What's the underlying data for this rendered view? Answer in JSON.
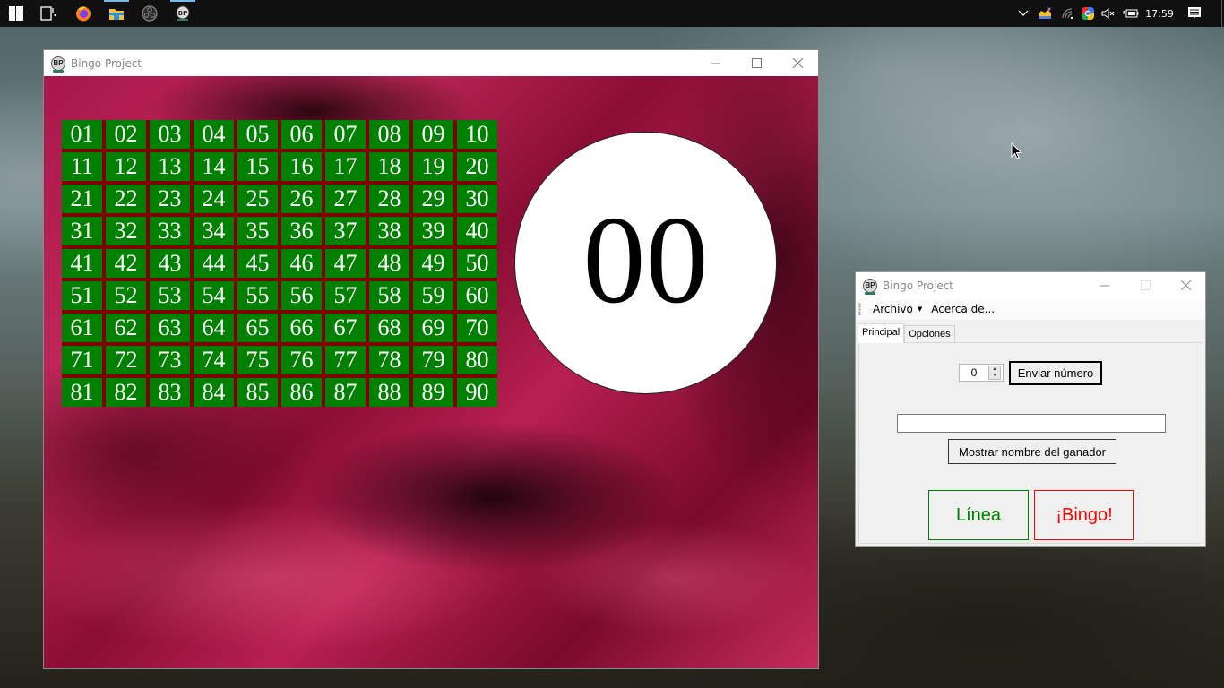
{
  "taskbar": {
    "apps": [
      {
        "name": "start",
        "icon": "windows-logo-icon"
      },
      {
        "name": "task-view",
        "icon": "task-view-icon"
      },
      {
        "name": "firefox",
        "icon": "firefox-icon"
      },
      {
        "name": "file-explorer",
        "icon": "folder-icon",
        "active": true
      },
      {
        "name": "obs",
        "icon": "obs-icon"
      },
      {
        "name": "bingo-project",
        "icon": "bingo-app-icon",
        "active": true
      }
    ],
    "tray": {
      "clock": "17:59",
      "icons": [
        "chevron-up-icon",
        "app-tray-icon",
        "wifi-icon",
        "chrome-remote-icon",
        "volume-muted-icon",
        "battery-charging-icon",
        "notification-icon"
      ]
    }
  },
  "main_window": {
    "title": "Bingo Project",
    "icon_text": "BP",
    "numbers": [
      "01",
      "02",
      "03",
      "04",
      "05",
      "06",
      "07",
      "08",
      "09",
      "10",
      "11",
      "12",
      "13",
      "14",
      "15",
      "16",
      "17",
      "18",
      "19",
      "20",
      "21",
      "22",
      "23",
      "24",
      "25",
      "26",
      "27",
      "28",
      "29",
      "30",
      "31",
      "32",
      "33",
      "34",
      "35",
      "36",
      "37",
      "38",
      "39",
      "40",
      "41",
      "42",
      "43",
      "44",
      "45",
      "46",
      "47",
      "48",
      "49",
      "50",
      "51",
      "52",
      "53",
      "54",
      "55",
      "56",
      "57",
      "58",
      "59",
      "60",
      "61",
      "62",
      "63",
      "64",
      "65",
      "66",
      "67",
      "68",
      "69",
      "70",
      "71",
      "72",
      "73",
      "74",
      "75",
      "76",
      "77",
      "78",
      "79",
      "80",
      "81",
      "82",
      "83",
      "84",
      "85",
      "86",
      "87",
      "88",
      "89",
      "90"
    ],
    "current_number": "00",
    "colors": {
      "cell": "#008000",
      "grid_bg": "#800000",
      "cell_text": "#ffffff"
    }
  },
  "control_window": {
    "title": "Bingo Project",
    "icon_text": "BP",
    "menu": {
      "archivo": "Archivo",
      "acerca": "Acerca de..."
    },
    "tabs": [
      {
        "label": "Principal",
        "selected": true
      },
      {
        "label": "Opciones",
        "selected": false
      }
    ],
    "spinner_value": "0",
    "send_button": "Enviar número",
    "winner_name_value": "",
    "show_winner_button": "Mostrar nombre del ganador",
    "linea_button": "Línea",
    "bingo_button": "¡Bingo!",
    "colors": {
      "linea": "#008000",
      "bingo": "#ff0000"
    }
  }
}
